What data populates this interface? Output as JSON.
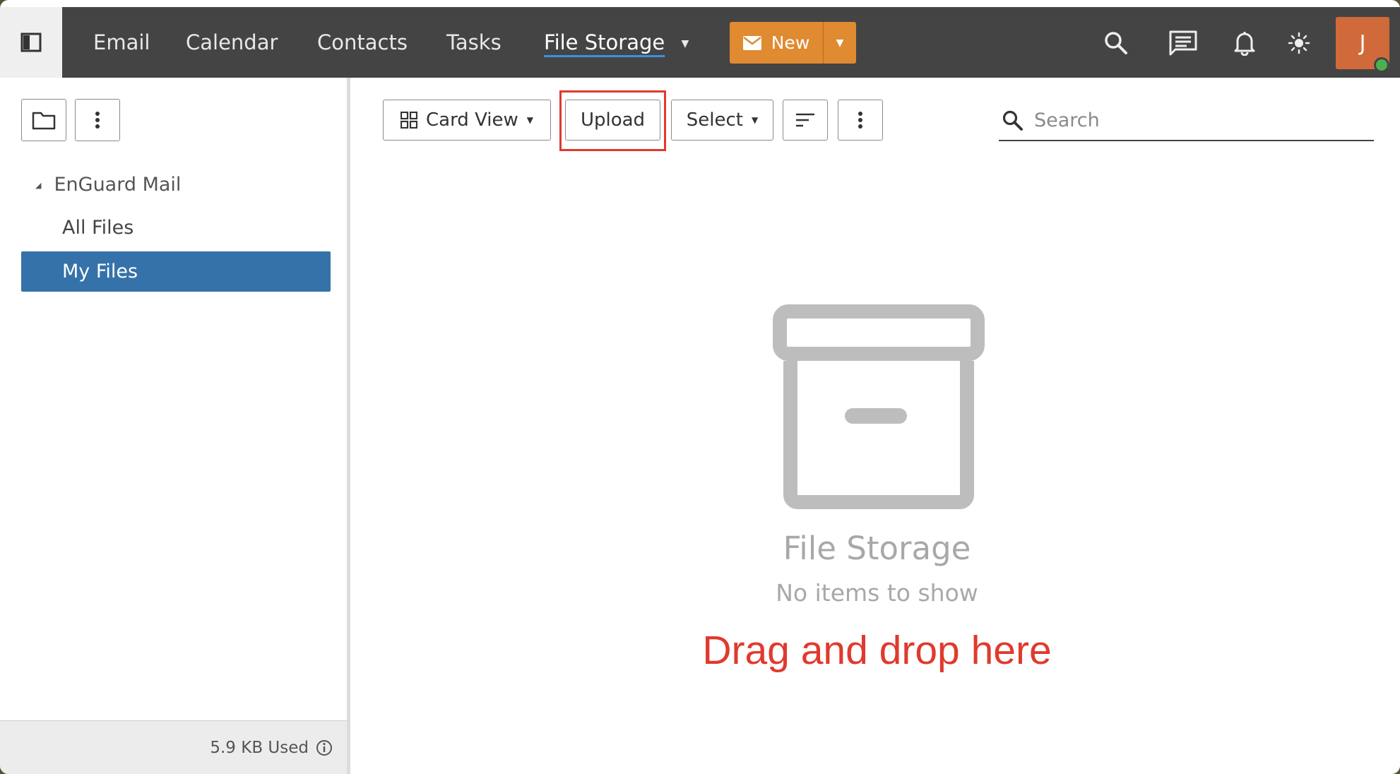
{
  "nav": {
    "items": [
      "Email",
      "Calendar",
      "Contacts",
      "Tasks",
      "File Storage"
    ],
    "active": "File Storage",
    "new_label": "New"
  },
  "user": {
    "initial": "J",
    "status": "online"
  },
  "icons": {
    "sidebar_toggle": "sidebar-toggle-icon",
    "search": "search-icon",
    "chat": "chat-icon",
    "notifications": "bell-icon",
    "theme": "sun-icon",
    "folder": "folder-icon",
    "more": "more-vertical-icon",
    "view": "grid-icon",
    "sort": "sort-icon",
    "empty": "archive-box-icon",
    "info": "info-icon"
  },
  "sidebar": {
    "root": "EnGuard Mail",
    "items": [
      {
        "label": "All Files",
        "selected": false
      },
      {
        "label": "My Files",
        "selected": true
      }
    ],
    "storage_used": "5.9 KB Used"
  },
  "toolbar": {
    "view_label": "Card View",
    "upload_label": "Upload",
    "select_label": "Select",
    "search_placeholder": "Search"
  },
  "empty_state": {
    "title": "File Storage",
    "subtitle": "No items to show",
    "drop_hint": "Drag and drop here"
  },
  "colors": {
    "topbar": "#444444",
    "accent_orange": "#e08a31",
    "selection_blue": "#3572aa",
    "highlight_red": "#e03a2e",
    "avatar": "#d06a3a",
    "presence_green": "#4caf50"
  }
}
